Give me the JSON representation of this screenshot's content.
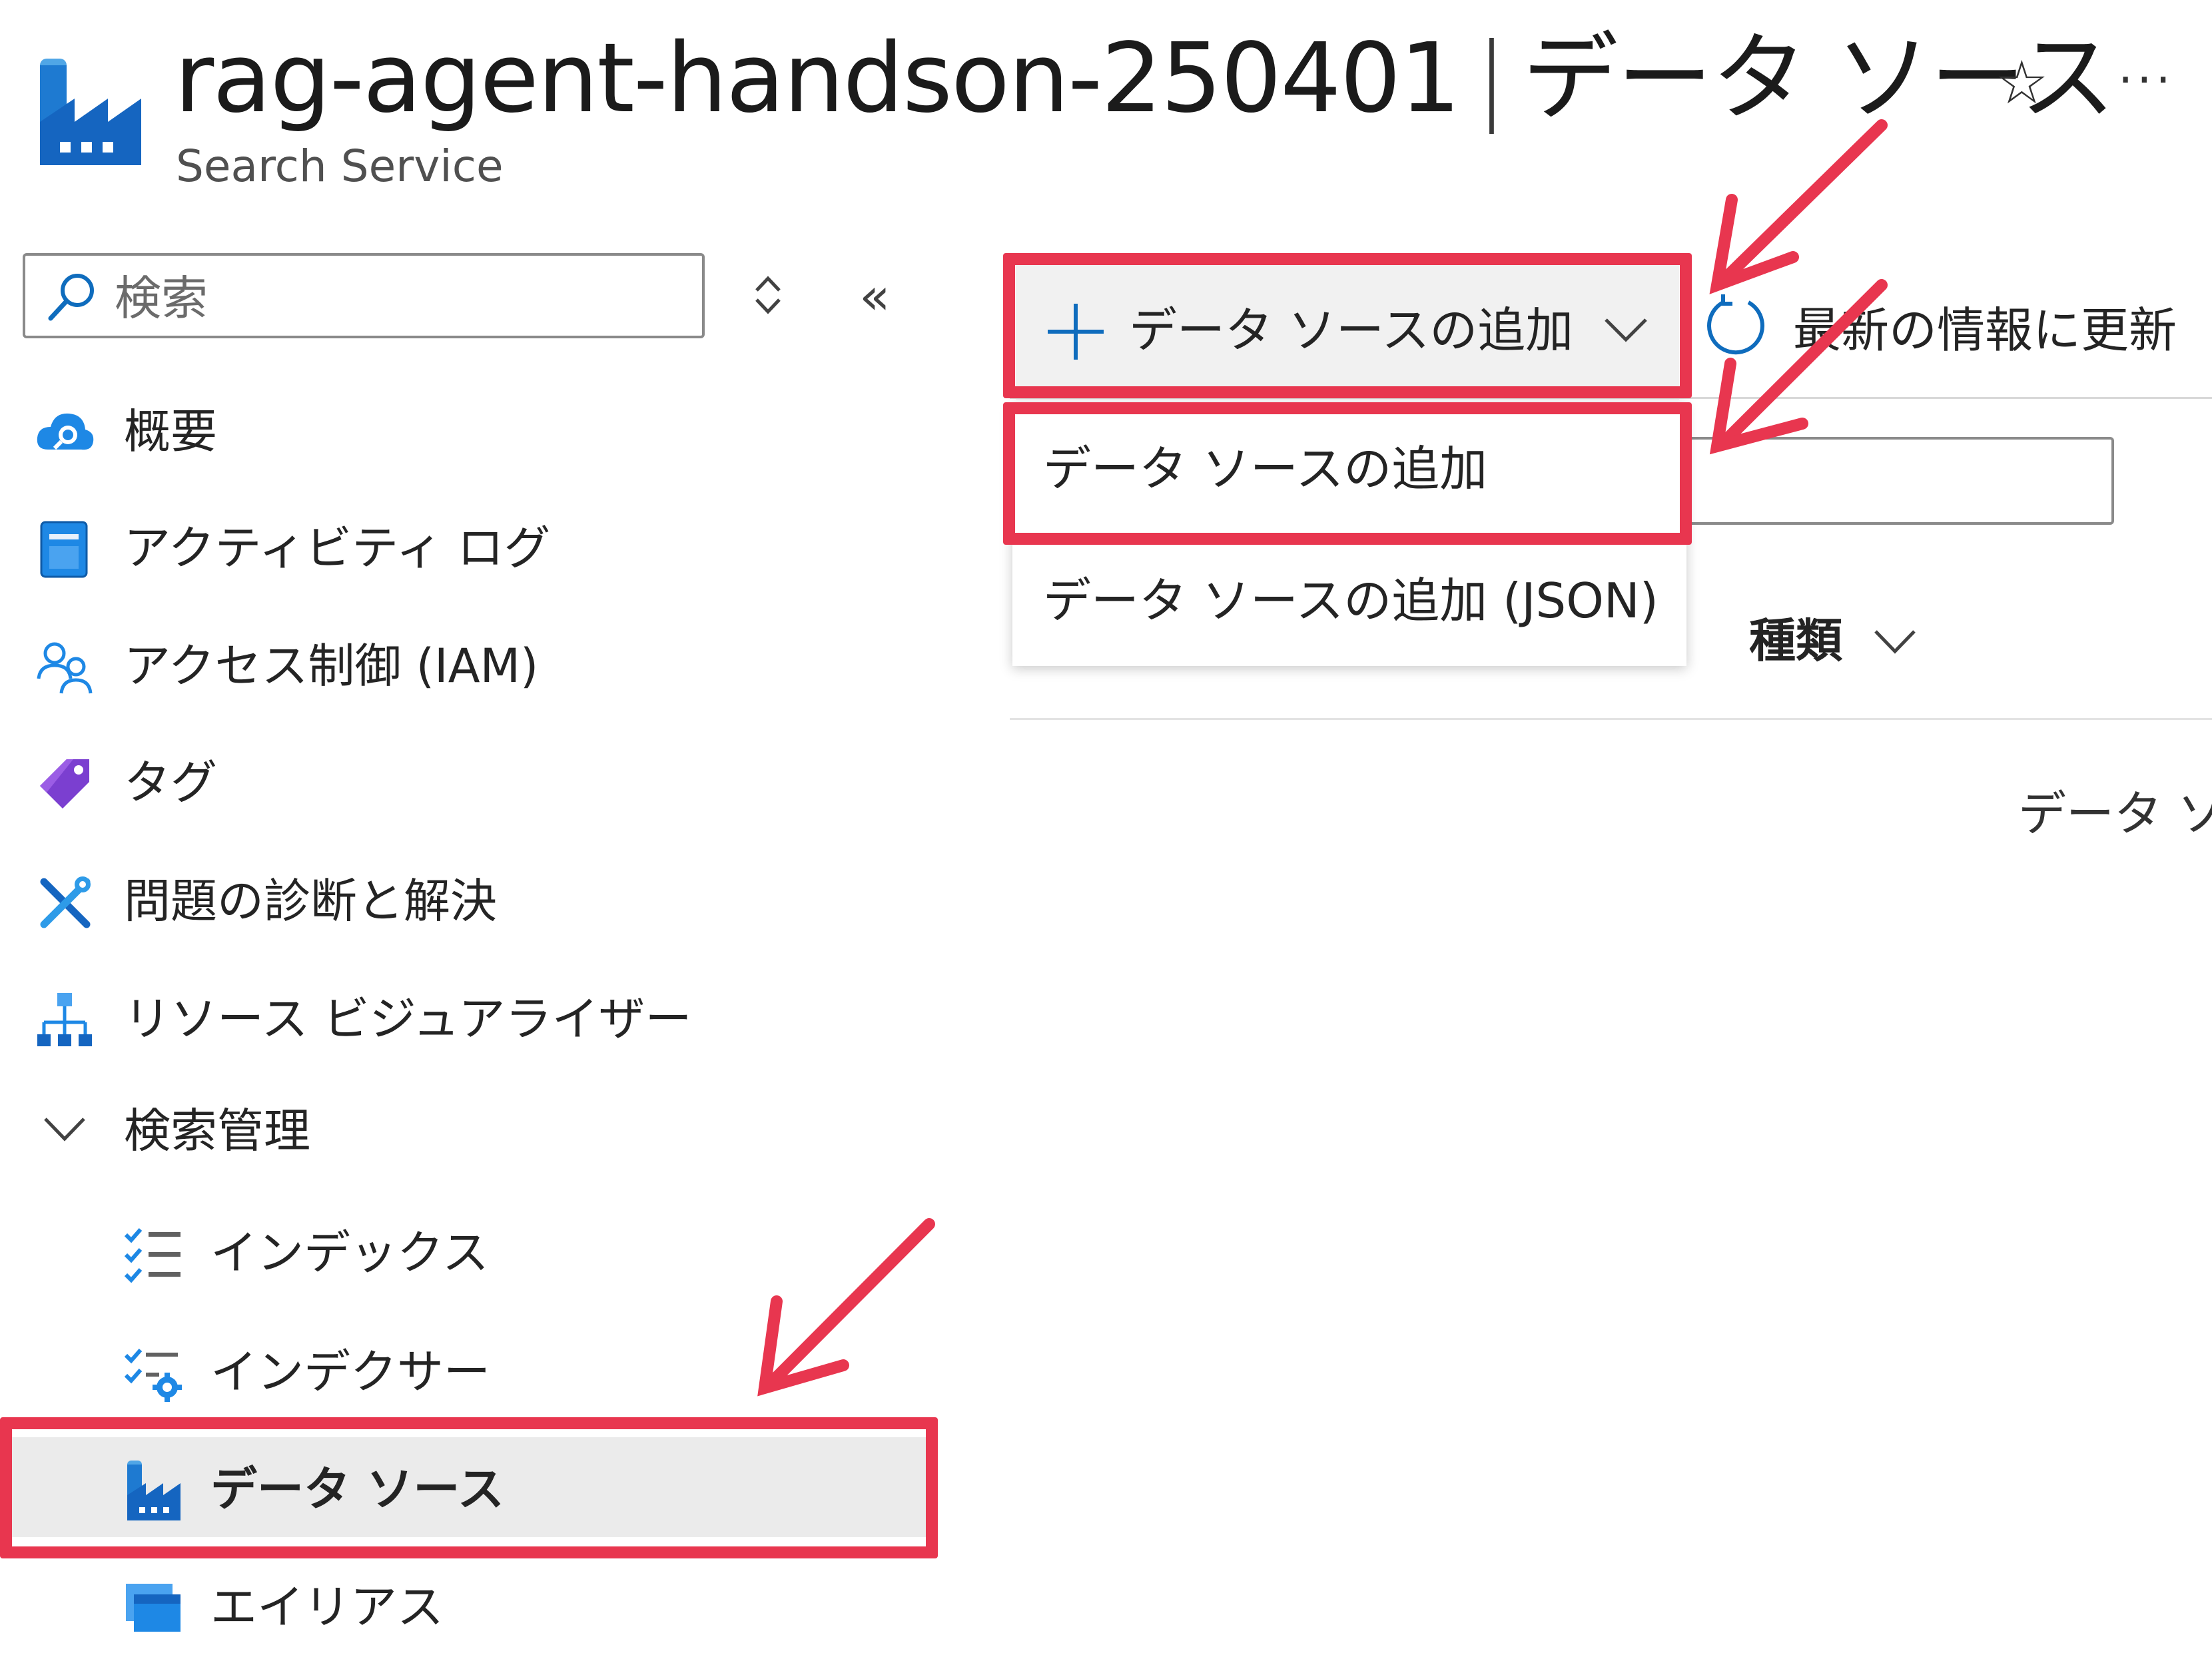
{
  "header": {
    "resource_name": "rag-agent-handson-250401",
    "separator": "|",
    "page_title": "データ ソース",
    "subtitle": "Search Service",
    "icons": [
      "data-source-factory-icon",
      "star-icon",
      "more-icon"
    ]
  },
  "sidebar": {
    "search_placeholder": "検索",
    "items": [
      {
        "label": "概要",
        "icon": "cloud-search-icon"
      },
      {
        "label": "アクティビティ ログ",
        "icon": "activity-log-icon"
      },
      {
        "label": "アクセス制御 (IAM)",
        "icon": "people-icon"
      },
      {
        "label": "タグ",
        "icon": "tag-icon"
      },
      {
        "label": "問題の診断と解決",
        "icon": "wrench-icon"
      },
      {
        "label": "リソース ビジュアライザー",
        "icon": "visualizer-icon"
      }
    ],
    "group": {
      "label": "検索管理",
      "expanded": true,
      "children": [
        {
          "label": "インデックス",
          "icon": "index-list-icon"
        },
        {
          "label": "インデクサー",
          "icon": "indexer-icon"
        },
        {
          "label": "データ ソース",
          "icon": "data-source-icon",
          "active": true
        },
        {
          "label": "エイリアス",
          "icon": "alias-icon"
        }
      ]
    }
  },
  "toolbar": {
    "add_label": "データ ソースの追加",
    "refresh_label": "最新の情報に更新"
  },
  "dropdown": {
    "items": [
      "データ ソースの追加",
      "データ ソースの追加 (JSON)"
    ]
  },
  "table": {
    "column_type": "種類",
    "empty_text": "データ ソ"
  },
  "colors": {
    "highlight": "#e8364f",
    "azure_blue": "#0f6cbd",
    "active_bg": "#ebebeb"
  }
}
